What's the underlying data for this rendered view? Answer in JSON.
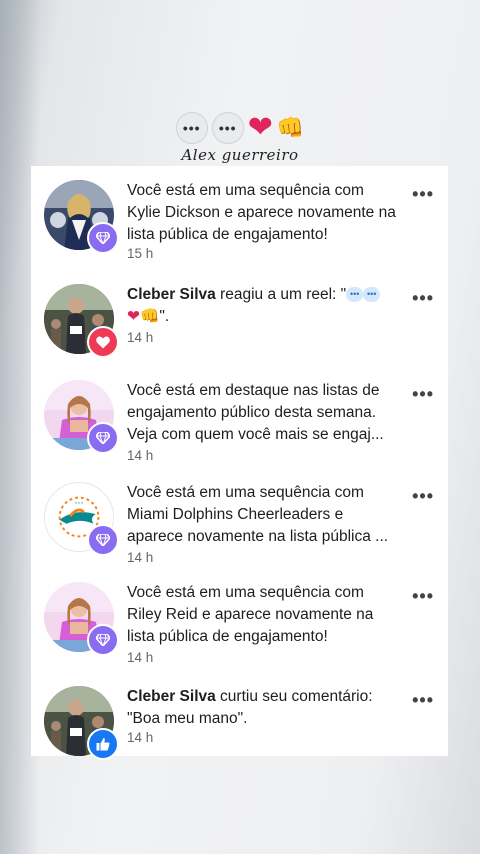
{
  "header": {
    "emojis": {
      "bubble": "•••",
      "heart": "❤",
      "fist": "👊"
    },
    "signature": "Alex guerreiro"
  },
  "notifications": [
    {
      "text": "Você está em uma sequência com Kylie Dickson e aparece novamente na lista pública de engajamento!",
      "time": "15 h",
      "badge": "diamond-icon"
    },
    {
      "name": "Cleber Silva",
      "text": " reagiu a um reel: \"",
      "suffix": "\".",
      "time": "14 h",
      "badge": "heart-icon"
    },
    {
      "text": "Você está em destaque nas listas de engajamento público desta semana. Veja com quem você mais se engaj...",
      "time": "14 h",
      "badge": "diamond-icon"
    },
    {
      "text": "Você está em uma sequência com Miami Dolphins Cheerleaders e aparece novamente na lista pública ...",
      "time": "14 h",
      "badge": "diamond-icon"
    },
    {
      "text": "Você está em uma sequência com Riley Reid e aparece novamente na lista pública de engajamento!",
      "time": "14 h",
      "badge": "diamond-icon"
    },
    {
      "name": "Cleber Silva",
      "text": " curtiu seu comentário: \"Boa meu mano\".",
      "time": "14 h",
      "badge": "thumbs-up-icon"
    }
  ],
  "more_label": "•••",
  "colors": {
    "badge_purple": "#8a6cf2",
    "badge_red": "#ee3a55",
    "badge_blue": "#1877f2"
  }
}
